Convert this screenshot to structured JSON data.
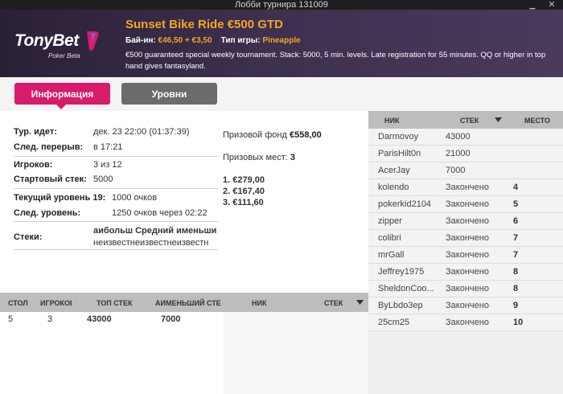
{
  "window": {
    "title": "Лобби турнира 131009"
  },
  "logo": {
    "brand": "TonyBet",
    "sub": "Poker Beta"
  },
  "tournament": {
    "name": "Sunset Bike Ride €500 GTD",
    "buyin_label": "Бай-ин:",
    "buyin_value": "€46,50 + €3,50",
    "game_label": "Тип игры:",
    "game_value": "Pineapple",
    "description": "€500 guaranteed special weekly tournament. Stack: 5000, 5 min. levels. Late registration for 55 minutes. QQ or higher in top hand gives fantasyland."
  },
  "tabs": {
    "info": "Информация",
    "levels": "Уровни"
  },
  "info": {
    "running_label": "Тур. идет:",
    "running_value": "дек. 23 22:00 (01:37:39)",
    "break_label": "След. перерыв:",
    "break_value": "в 17:21",
    "players_label": "Игроков:",
    "players_value": "3 из 12",
    "start_stack_label": "Стартовый стек:",
    "start_stack_value": "5000",
    "current_level_label": "Текущий уровень 19:",
    "current_level_value": "1000 очков",
    "next_level_label": "След. уровень:",
    "next_level_value": "1250 очков через 02:22",
    "stacks_label": "Стеки:",
    "stacks_line1": "аибольш Средний именьши",
    "stacks_line2": "неизвестнеизвестнеизвестн"
  },
  "prize": {
    "pool_label": "Призовой фонд",
    "pool_value": "€558,00",
    "places_label": "Призовых мест:",
    "places_value": "3",
    "p1": "1. €279,00",
    "p2": "2. €167,40",
    "p3": "3. €111,60"
  },
  "tables": {
    "headers": {
      "table": "СТОЛ",
      "players": "ИГРОКОІ",
      "top": "ТОП СТЕК",
      "min": "АИМЕНЬШИЙ СТЕ"
    },
    "row": {
      "table": "5",
      "players": "3",
      "top": "43000",
      "min": "7000"
    }
  },
  "seat": {
    "headers": {
      "nick": "НИК",
      "stack": "СТЕК"
    }
  },
  "players": {
    "headers": {
      "nick": "НИК",
      "stack": "СТЕК",
      "place": "МЕСТО"
    },
    "rows": [
      {
        "nick": "Darmovoy",
        "stack": "43000",
        "place": ""
      },
      {
        "nick": "ParisHilt0n",
        "stack": "21000",
        "place": ""
      },
      {
        "nick": "AcerJay",
        "stack": "7000",
        "place": ""
      },
      {
        "nick": "kolendo",
        "stack": "Закончено",
        "place": "4"
      },
      {
        "nick": "pokerkid2104",
        "stack": "Закончено",
        "place": "5"
      },
      {
        "nick": "zipper",
        "stack": "Закончено",
        "place": "6"
      },
      {
        "nick": "colibri",
        "stack": "Закончено",
        "place": "7"
      },
      {
        "nick": "mrGall",
        "stack": "Закончено",
        "place": "7"
      },
      {
        "nick": "Jeffrey1975",
        "stack": "Закончено",
        "place": "8"
      },
      {
        "nick": "SheldonCoo...",
        "stack": "Закончено",
        "place": "8"
      },
      {
        "nick": "ByLbdo3ep",
        "stack": "Закончено",
        "place": "9"
      },
      {
        "nick": "25cm25",
        "stack": "Закончено",
        "place": "10"
      }
    ]
  },
  "colors": {
    "accent": "#d81b6a",
    "highlight": "#f5a623",
    "header_bg": "#3d2f4e"
  }
}
